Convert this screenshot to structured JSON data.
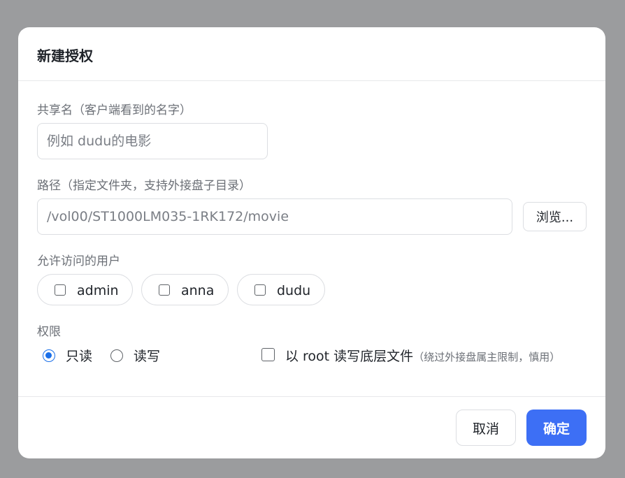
{
  "dialog": {
    "title": "新建授权",
    "share_name": {
      "label": "共享名（客户端看到的名字）",
      "placeholder": "例如 dudu的电影",
      "value": ""
    },
    "path": {
      "label": "路径（指定文件夹，支持外接盘子目录）",
      "value": "/vol00/ST1000LM035-1RK172/movie",
      "browse_label": "浏览..."
    },
    "users": {
      "label": "允许访问的用户",
      "items": [
        {
          "name": "admin",
          "checked": false
        },
        {
          "name": "anna",
          "checked": false
        },
        {
          "name": "dudu",
          "checked": false
        }
      ]
    },
    "permission": {
      "label": "权限",
      "options": [
        {
          "label": "只读",
          "selected": true
        },
        {
          "label": "读写",
          "selected": false
        }
      ],
      "root_option": {
        "label": "以 root 读写底层文件",
        "note": "（绕过外接盘属主限制，慎用）",
        "checked": false
      }
    },
    "footer": {
      "cancel_label": "取消",
      "ok_label": "确定"
    }
  },
  "colors": {
    "overlay": "#9b9c9e",
    "primary": "#3d6ff5",
    "radio_accent": "#1a6fe8"
  }
}
